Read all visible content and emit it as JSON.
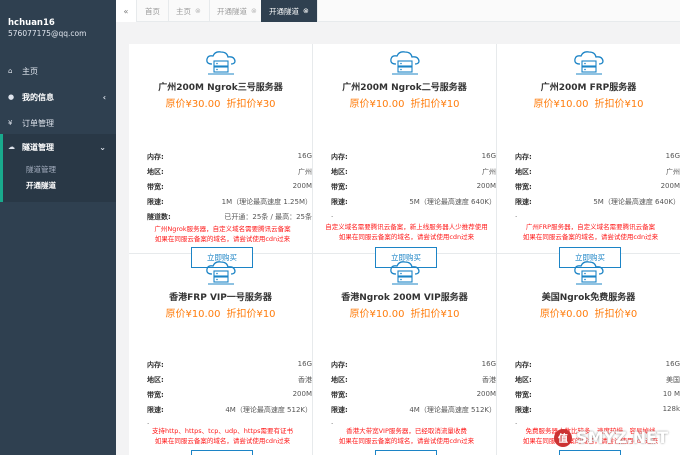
{
  "user": {
    "name": "hchuan16",
    "email": "576077175@qq.com"
  },
  "sidebar": {
    "items": [
      {
        "icon": "home-icon",
        "label": "主页"
      },
      {
        "icon": "user-icon",
        "label": "我的信息",
        "arrow": "‹"
      },
      {
        "icon": "yen-icon",
        "label": "订单管理"
      },
      {
        "icon": "cloud-icon",
        "label": "隧道管理",
        "arrow": "⌄"
      }
    ],
    "submenu": [
      "隧道管理",
      "开通隧道"
    ]
  },
  "tabs": [
    {
      "label": "首页"
    },
    {
      "label": "主页",
      "close": "⊗"
    },
    {
      "label": "开通隧道",
      "close": "⊗"
    },
    {
      "label": "开通隧道",
      "close": "⊗"
    }
  ],
  "labels": {
    "memory": "内存:",
    "region": "地区:",
    "bandwidth": "带宽:",
    "speed": "限速:",
    "tunnels": "隧道数:",
    "buy": "立即购买",
    "dot": "."
  },
  "cards": [
    {
      "title": "广州200M Ngrok三号服务器",
      "orig": "原价¥30.00",
      "disc": "折扣价¥30",
      "memory": "16G",
      "region": "广州",
      "bandwidth": "200M",
      "speed": "1M（理论最高速度 1.25M）",
      "tunnels": "已开通：25条 / 最高：25条",
      "note1": "广州Ngrok服务器，自定义域名需要腾讯云备案",
      "note2": "如果在同服云备案的域名，请尝试使用cdn过来"
    },
    {
      "title": "广州200M Ngrok二号服务器",
      "orig": "原价¥10.00",
      "disc": "折扣价¥10",
      "memory": "16G",
      "region": "广州",
      "bandwidth": "200M",
      "speed": "5M（理论最高速度 640K）",
      "note1": "自定义域名需要腾讯云备案，新上线服务器人少推荐使用",
      "note2": "如果在同服云备案的域名，请尝试使用cdn过来"
    },
    {
      "title": "广州200M FRP服务器",
      "orig": "原价¥10.00",
      "disc": "折扣价¥10",
      "memory": "16G",
      "region": "广州",
      "bandwidth": "200M",
      "speed": "5M（理论最高速度 640K）",
      "note1": "广州FRP服务器，自定义域名需要腾讯云备案",
      "note2": "如果在同服云备案的域名，请尝试使用cdn过来"
    },
    {
      "title": "香港FRP VIP一号服务器",
      "orig": "原价¥10.00",
      "disc": "折扣价¥10",
      "memory": "16G",
      "region": "香港",
      "bandwidth": "200M",
      "speed": "4M（理论最高速度 512K）",
      "note1": "支持http、https、tcp、udp、https需要有证书",
      "note2": "如果在同服云备案的域名，请尝试使用cdn过来"
    },
    {
      "title": "香港Ngrok 200M VIP服务器",
      "orig": "原价¥10.00",
      "disc": "折扣价¥10",
      "memory": "16G",
      "region": "香港",
      "bandwidth": "200M",
      "speed": "4M（理论最高速度 512K）",
      "note1": "香港大带宽VIP服务器，已经取消流量收费",
      "note2": "如果在同服云备案的域名，请尝试使用cdn过来"
    },
    {
      "title": "美国Ngrok免费服务器",
      "orig": "原价¥0.00",
      "disc": "折扣价¥0",
      "memory": "16G",
      "region": "美国",
      "bandwidth": "10 M",
      "speed": "128k",
      "note1": "免费服务器人数比较多，速度较慢，容易掉线",
      "note2": "如果在同服云备案的域名，请尝试使用cdn过来"
    }
  ],
  "watermark": {
    "badge": "值",
    "text": "SMYZ.NET"
  },
  "colors": {
    "sidebar": "#2f4050",
    "accent": "#19aa8d",
    "price": "#ff7d0d",
    "note": "#ff1a1a",
    "button": "#1c84c6"
  }
}
